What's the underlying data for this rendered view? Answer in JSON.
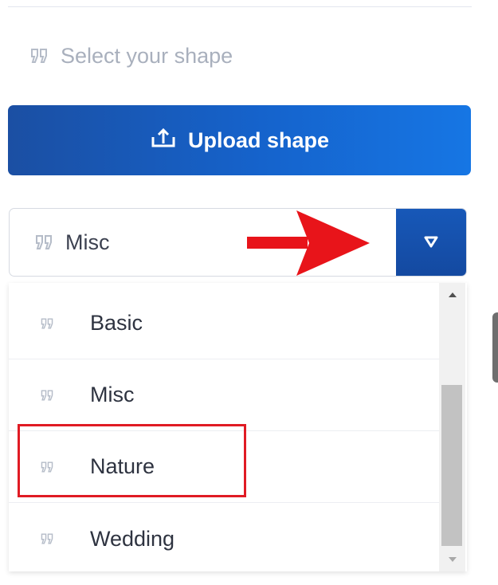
{
  "shape_picker": {
    "prompt": "Select your shape",
    "upload_label": "Upload shape",
    "selected": "Misc",
    "options": [
      {
        "label": "Basic"
      },
      {
        "label": "Misc"
      },
      {
        "label": "Nature"
      },
      {
        "label": "Wedding"
      }
    ]
  },
  "icons": {
    "quote": "quote-icon",
    "upload": "upload-icon",
    "caret": "triangle-down-icon",
    "scroll_up": "triangle-up-icon",
    "scroll_down": "triangle-down-icon"
  },
  "colors": {
    "accent": "#1563cc",
    "highlight": "#e01b24",
    "annotation_arrow": "#e8141a",
    "muted_text": "#a9b0bd"
  }
}
